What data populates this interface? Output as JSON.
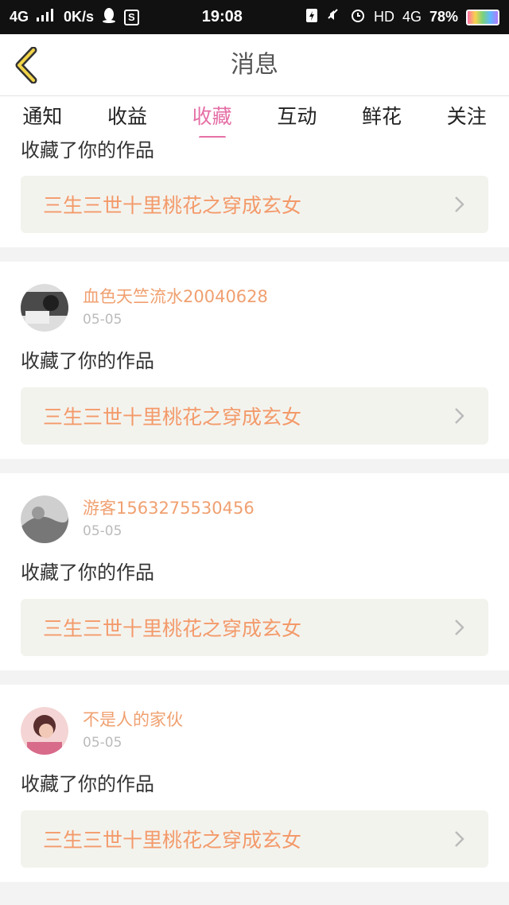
{
  "status_bar": {
    "network": "4G",
    "speed": "0K/s",
    "time": "19:08",
    "hd": "HD",
    "network2": "4G",
    "battery": "78%"
  },
  "header": {
    "title": "消息"
  },
  "tabs": [
    {
      "label": "通知"
    },
    {
      "label": "收益"
    },
    {
      "label": "收藏",
      "active": true
    },
    {
      "label": "互动"
    },
    {
      "label": "鲜花"
    },
    {
      "label": "关注"
    }
  ],
  "items": [
    {
      "message": "收藏了你的作品",
      "work": "三生三世十里桃花之穿成玄女"
    },
    {
      "user": "血色天竺流水20040628",
      "date": "05-05",
      "message": "收藏了你的作品",
      "work": "三生三世十里桃花之穿成玄女"
    },
    {
      "user": "游客1563275530456",
      "date": "05-05",
      "message": "收藏了你的作品",
      "work": "三生三世十里桃花之穿成玄女"
    },
    {
      "user": "不是人的家伙",
      "date": "05-05",
      "message": "收藏了你的作品",
      "work": "三生三世十里桃花之穿成玄女"
    }
  ],
  "colors": {
    "accent": "#e56fa6",
    "work_text": "#f39a6a",
    "username": "#f0a070"
  }
}
